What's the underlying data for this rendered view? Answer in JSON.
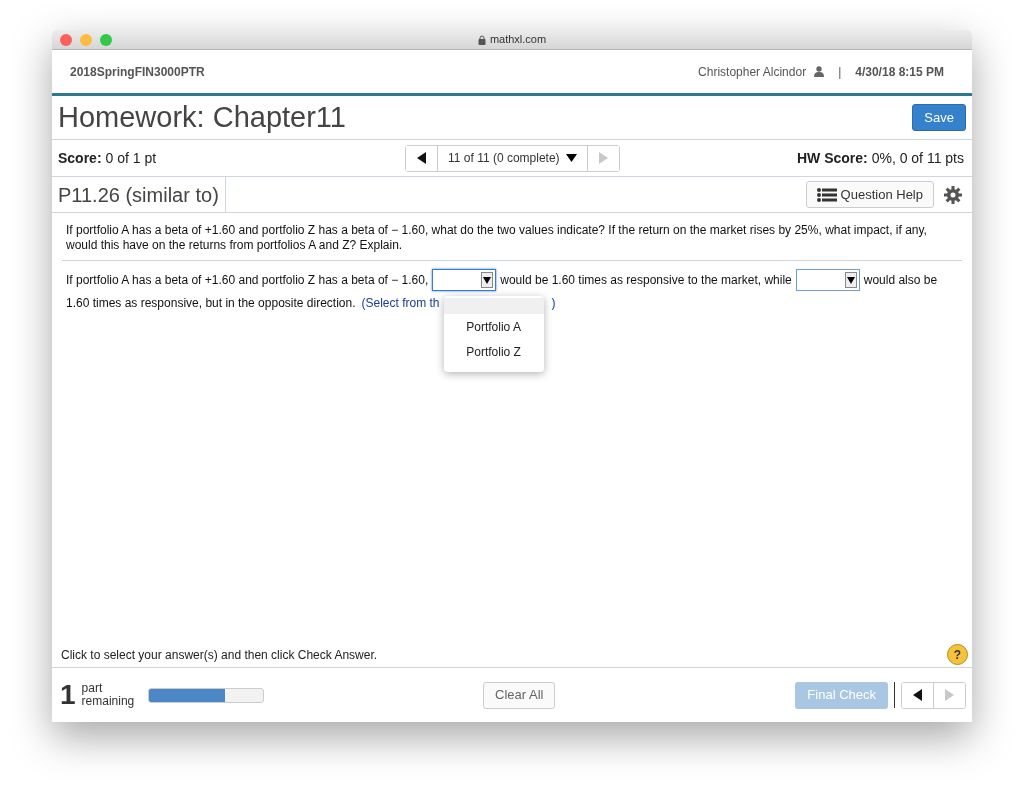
{
  "browser": {
    "address": "mathxl.com"
  },
  "header": {
    "course": "2018SpringFIN3000PTR",
    "user": "Christopher Alcindor",
    "separator": "|",
    "datetime": "4/30/18 8:15 PM"
  },
  "title": "Homework: Chapter11",
  "save_button": "Save",
  "score": {
    "label": "Score:",
    "value": "0 of 1 pt"
  },
  "navigator": {
    "position": "11 of 11 (0 complete)",
    "prev_disabled": false,
    "next_disabled": true
  },
  "hw_score": {
    "label": "HW Score:",
    "value": "0%, 0 of 11 pts"
  },
  "question": {
    "id": "P11.26 (similar to)",
    "help_button": "Question Help"
  },
  "prompt": "If portfolio A has a beta of +1.60 and portfolio Z has a beta of − 1.60, what do the two values indicate?  If the return on the market rises by 25%, what impact, if any, would this have on the returns from portfolios A and Z?  Explain.",
  "answer": {
    "lead": "If portfolio A has a beta of +1.60 and portfolio Z has a beta of − 1.60,",
    "middle": "would be 1.60 times as responsive to the market, while",
    "trail": "would also be",
    "trail_2": "1.60 times as responsive, but in the opposite direction.",
    "hint_start": "(Select from th",
    "hint_end": ")",
    "dropdowns": [
      {
        "open": true
      },
      {
        "open": false
      }
    ],
    "menu_options": [
      {
        "label": "Portfolio A",
        "selected": false
      },
      {
        "label": "Portfolio Z",
        "selected": false
      }
    ]
  },
  "instruction": "Click to select your answer(s) and then click Check Answer.",
  "help_icon": "?",
  "footer": {
    "parts_count": "1",
    "parts_label": "part remaining",
    "progress": {
      "level": 0.67
    },
    "clear_button": "Clear All",
    "final_check": {
      "label": "Final Check",
      "disabled": true
    },
    "prev_disabled": false,
    "next_disabled": true
  }
}
